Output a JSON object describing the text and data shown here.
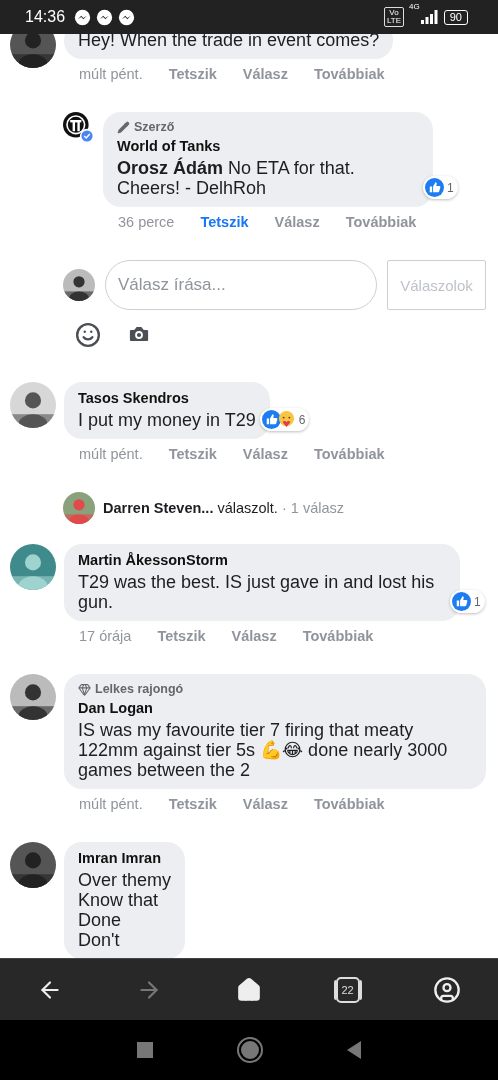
{
  "status_bar": {
    "time": "14:36",
    "notifications": [
      {
        "kind": "messenger"
      },
      {
        "kind": "messenger"
      },
      {
        "kind": "messenger"
      }
    ],
    "network_badge": [
      "Vo",
      "LTE"
    ],
    "network_type": "4G",
    "battery": "90"
  },
  "thread": [
    {
      "kind": "comment",
      "indent": false,
      "text": "Hey! When the trade in event comes?",
      "time": "múlt pént.",
      "actions": [
        {
          "label": "Tetszik",
          "selected": false
        },
        {
          "label": "Válasz",
          "selected": false
        },
        {
          "label": "Továbbiak",
          "selected": false
        }
      ]
    },
    {
      "kind": "comment",
      "indent": true,
      "avatar": {
        "kind": "logo"
      },
      "verified": true,
      "badge": {
        "kind": "author",
        "label": "Szerző"
      },
      "author": "World of Tanks",
      "text": "**Orosz Ádám** No ETA for that. Cheers! - DelhRoh",
      "reactions": {
        "kinds": [
          {
            "kind": "like"
          }
        ],
        "count": "1"
      },
      "time": "36 perce",
      "actions": [
        {
          "label": "Tetszik",
          "selected": true
        },
        {
          "label": "Válasz",
          "selected": false
        },
        {
          "label": "Továbbiak",
          "selected": false
        }
      ]
    },
    {
      "kind": "composer",
      "placeholder": "Válasz írása...",
      "button": {
        "label": "Válaszolok",
        "disabled": true
      }
    },
    {
      "kind": "comment",
      "indent": false,
      "author": "Tasos Skendros",
      "text": "I put my money in T29",
      "reactions": {
        "kinds": [
          {
            "kind": "like"
          },
          {
            "kind": "care"
          }
        ],
        "count": "6"
      },
      "time": "múlt pént.",
      "actions": [
        {
          "label": "Tetszik",
          "selected": false
        },
        {
          "label": "Válasz",
          "selected": false
        },
        {
          "label": "Továbbiak",
          "selected": false
        }
      ]
    },
    {
      "kind": "reply_summary",
      "text": "**Darren Steven...** válaszolt.",
      "count": "· 1 válasz"
    },
    {
      "kind": "comment",
      "indent": false,
      "author": "Martin ÅkessonStorm",
      "text": "T29 was the best. IS just gave in and lost his gun.",
      "reactions": {
        "kinds": [
          {
            "kind": "like"
          }
        ],
        "count": "1"
      },
      "time": "17 órája",
      "actions": [
        {
          "label": "Tetszik",
          "selected": false
        },
        {
          "label": "Válasz",
          "selected": false
        },
        {
          "label": "Továbbiak",
          "selected": false
        }
      ]
    },
    {
      "kind": "comment",
      "indent": false,
      "badge": {
        "kind": "fan",
        "label": "Lelkes rajongó"
      },
      "author": "Dan Logan",
      "text": "IS was my favourite tier 7 firing that meaty 122mm against tier 5s 💪😂 done nearly 3000 games between the 2",
      "time": "múlt pént.",
      "actions": [
        {
          "label": "Tetszik",
          "selected": false
        },
        {
          "label": "Válasz",
          "selected": false
        },
        {
          "label": "Továbbiak",
          "selected": false
        }
      ]
    },
    {
      "kind": "comment",
      "indent": false,
      "author": "Imran Imran",
      "text": "Over themy\nKnow that\nDone\nDon't"
    }
  ],
  "browser_bar": {
    "back_disabled": false,
    "forward_disabled": true,
    "tab_count": "22"
  }
}
